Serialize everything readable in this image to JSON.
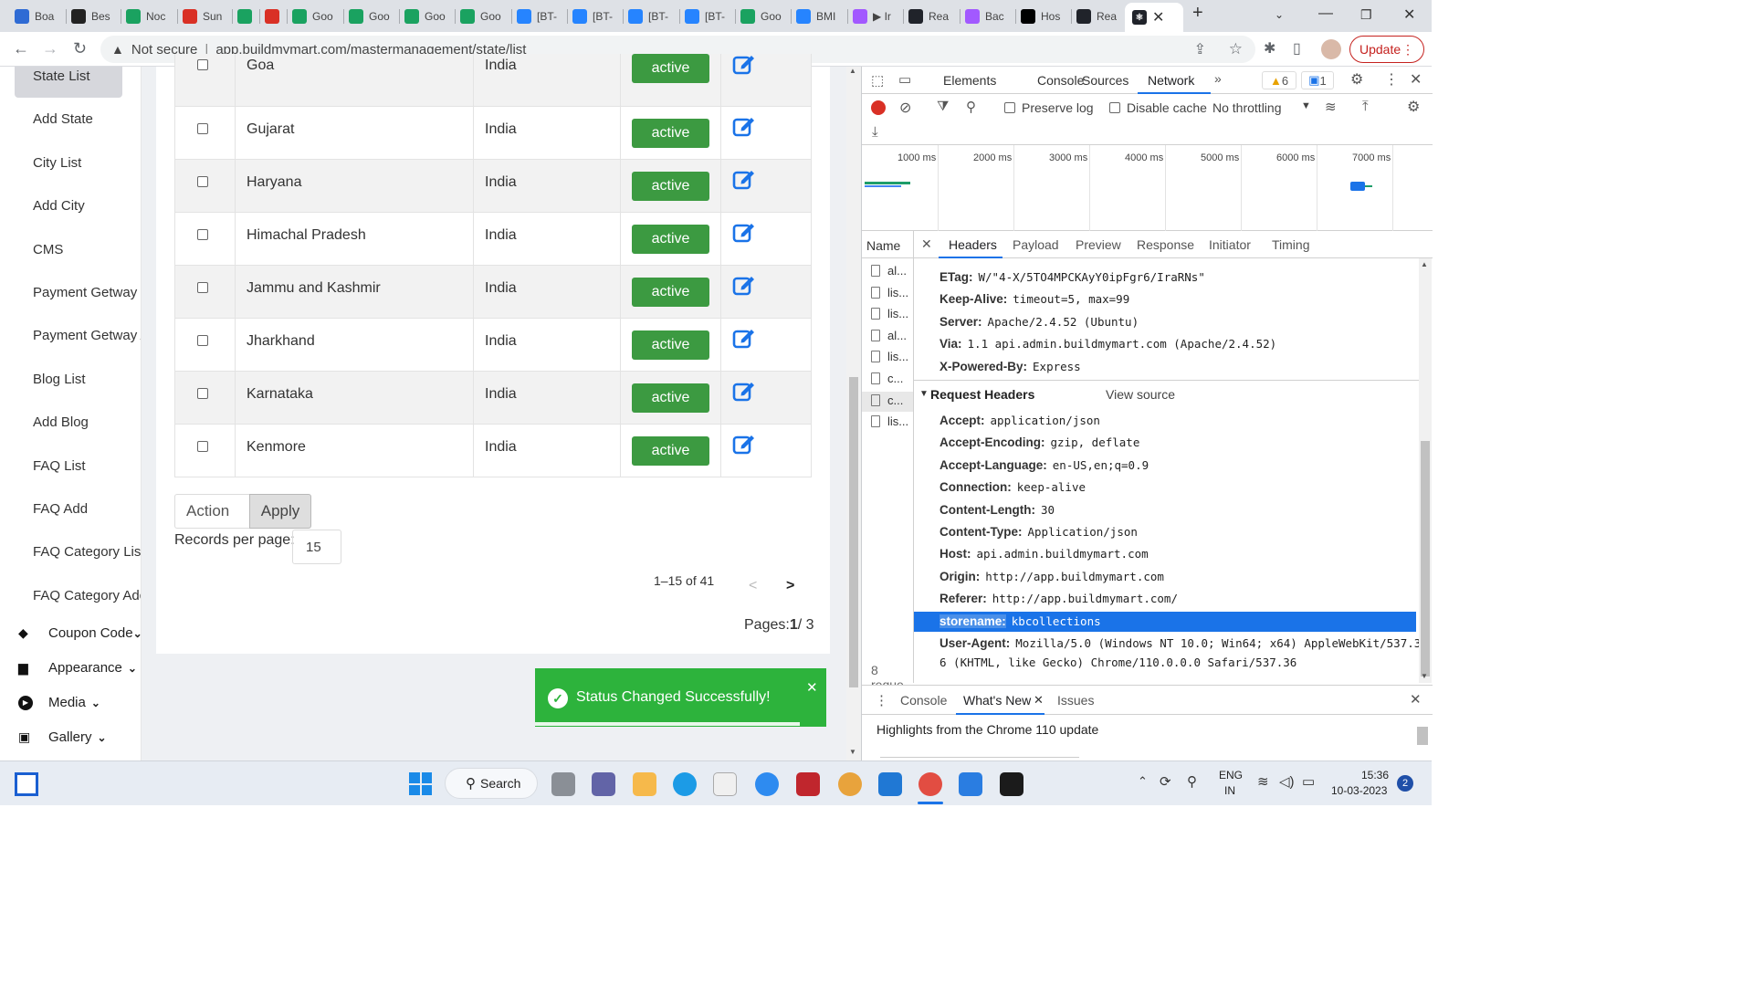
{
  "browser": {
    "tabs": [
      {
        "label": "Boa",
        "icon": "bookmark-icon",
        "color": "#2f6bd4"
      },
      {
        "label": "Bes",
        "icon": "jotform-icon",
        "color": "#222222"
      },
      {
        "label": "Noc",
        "icon": "plus-icon",
        "color": "#1aa260"
      },
      {
        "label": "Sun",
        "icon": "gmail-icon",
        "color": "#d93025"
      },
      {
        "label": "",
        "icon": "meet-icon",
        "color": "#1aa260"
      },
      {
        "label": "",
        "icon": "record-icon",
        "color": "#d93025"
      },
      {
        "label": "Goo",
        "icon": "meet-icon",
        "color": "#1aa260"
      },
      {
        "label": "Goo",
        "icon": "meet-icon",
        "color": "#1aa260"
      },
      {
        "label": "Goo",
        "icon": "meet-icon",
        "color": "#1aa260"
      },
      {
        "label": "Goo",
        "icon": "meet-icon",
        "color": "#1aa260"
      },
      {
        "label": "[BT-",
        "icon": "jira-icon",
        "color": "#2684ff"
      },
      {
        "label": "[BT-",
        "icon": "jira-icon",
        "color": "#2684ff"
      },
      {
        "label": "[BT-",
        "icon": "jira-icon",
        "color": "#2684ff"
      },
      {
        "label": "[BT-",
        "icon": "jira-icon",
        "color": "#2684ff"
      },
      {
        "label": "Goo",
        "icon": "meet-icon",
        "color": "#1aa260"
      },
      {
        "label": "BMI",
        "icon": "jira-icon",
        "color": "#2684ff"
      },
      {
        "label": "▶ Ir",
        "icon": "figma-icon",
        "color": "#a259ff"
      },
      {
        "label": "Rea",
        "icon": "react-icon",
        "color": "#20232a"
      },
      {
        "label": "Bac",
        "icon": "figma-icon",
        "color": "#a259ff"
      },
      {
        "label": "Hos",
        "icon": "medium-icon",
        "color": "#000000"
      },
      {
        "label": "Rea",
        "icon": "react-icon",
        "color": "#20232a"
      }
    ],
    "not_secure": "Not secure",
    "url": "app.buildmymart.com/mastermanagement/state/list",
    "update_label": "Update"
  },
  "sidebar": {
    "items": [
      "State List",
      "Add State",
      "City List",
      "Add City",
      "CMS",
      "Payment Getway I",
      "Payment Getway A",
      "Blog List",
      "Add Blog",
      "FAQ List",
      "FAQ Add",
      "FAQ Category List",
      "FAQ Category Add"
    ],
    "groups": [
      {
        "label": "Coupon Code",
        "icon": "tag-icon"
      },
      {
        "label": "Appearance",
        "icon": "bag-icon"
      },
      {
        "label": "Media",
        "icon": "play-icon"
      },
      {
        "label": "Gallery",
        "icon": "image-icon"
      }
    ]
  },
  "table": {
    "rows": [
      {
        "state": "Goa",
        "country": "India",
        "status": "active"
      },
      {
        "state": "Gujarat",
        "country": "India",
        "status": "active"
      },
      {
        "state": "Haryana",
        "country": "India",
        "status": "active"
      },
      {
        "state": "Himachal Pradesh",
        "country": "India",
        "status": "active"
      },
      {
        "state": "Jammu and Kashmir",
        "country": "India",
        "status": "active"
      },
      {
        "state": "Jharkhand",
        "country": "India",
        "status": "active"
      },
      {
        "state": "Karnataka",
        "country": "India",
        "status": "active"
      },
      {
        "state": "Kenmore",
        "country": "India",
        "status": "active"
      }
    ],
    "action_label": "Action",
    "apply_label": "Apply",
    "records_label": "Records per page:",
    "records_value": "15",
    "range_text": "1–15 of 41",
    "pages_prefix": "Pages:",
    "pages_current": "1",
    "pages_total": "/ 3"
  },
  "toast": {
    "message": "Status Changed Successfully!",
    "color": "#2db33c"
  },
  "devtools": {
    "tabs": [
      "Elements",
      "Console",
      "Sources",
      "Network"
    ],
    "active_tab": "Network",
    "warnings": "6",
    "messages": "1",
    "toolbar": {
      "preserve_log": "Preserve log",
      "disable_cache": "Disable cache",
      "throttling": "No throttling"
    },
    "timeline_ticks": [
      "1000 ms",
      "2000 ms",
      "3000 ms",
      "4000 ms",
      "5000 ms",
      "6000 ms",
      "7000 ms"
    ],
    "name_header": "Name",
    "request_names": [
      "al...",
      "lis...",
      "lis...",
      "al...",
      "lis...",
      "c...",
      "c...",
      "lis..."
    ],
    "requests_count": "8 reque",
    "detail_tabs": [
      "Headers",
      "Payload",
      "Preview",
      "Response",
      "Initiator",
      "Timing"
    ],
    "response_headers": [
      {
        "key": "ETag:",
        "value": "W/\"4-X/5TO4MPCKAyY0ipFgr6/IraRNs\""
      },
      {
        "key": "Keep-Alive:",
        "value": "timeout=5, max=99"
      },
      {
        "key": "Server:",
        "value": "Apache/2.4.52 (Ubuntu)"
      },
      {
        "key": "Via:",
        "value": "1.1 api.admin.buildmymart.com (Apache/2.4.52)"
      },
      {
        "key": "X-Powered-By:",
        "value": "Express"
      }
    ],
    "request_headers_title": "Request Headers",
    "view_source": "View source",
    "request_headers": [
      {
        "key": "Accept:",
        "value": "application/json"
      },
      {
        "key": "Accept-Encoding:",
        "value": "gzip, deflate"
      },
      {
        "key": "Accept-Language:",
        "value": "en-US,en;q=0.9"
      },
      {
        "key": "Connection:",
        "value": "keep-alive"
      },
      {
        "key": "Content-Length:",
        "value": "30"
      },
      {
        "key": "Content-Type:",
        "value": "Application/json"
      },
      {
        "key": "Host:",
        "value": "api.admin.buildmymart.com"
      },
      {
        "key": "Origin:",
        "value": "http://app.buildmymart.com"
      },
      {
        "key": "Referer:",
        "value": "http://app.buildmymart.com/"
      },
      {
        "key": "storename:",
        "value": "kbcollections"
      },
      {
        "key": "User-Agent:",
        "value": "Mozilla/5.0 (Windows NT 10.0; Win64; x64) AppleWebKit/537.3"
      }
    ],
    "user_agent_cont": "6 (KHTML, like Gecko) Chrome/110.0.0.0 Safari/537.36",
    "drawer_tabs": [
      "Console",
      "What's New",
      "Issues"
    ],
    "drawer_text": "Highlights from the Chrome 110 update"
  },
  "taskbar": {
    "search_label": "Search",
    "lang": "ENG",
    "region": "IN",
    "time": "15:36",
    "date": "10-03-2023",
    "notif_count": "2"
  }
}
